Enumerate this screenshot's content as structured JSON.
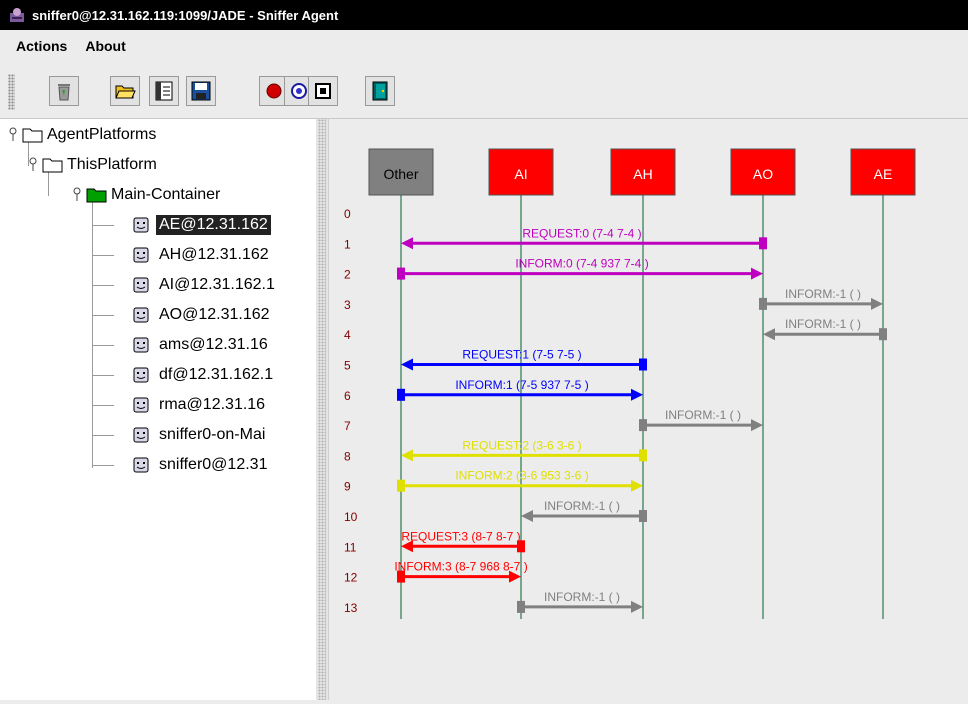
{
  "window": {
    "title": "sniffer0@12.31.162.119:1099/JADE - Sniffer Agent"
  },
  "menu": [
    "Actions",
    "About"
  ],
  "toolbar": {
    "buttons": [
      {
        "name": "clear-canvas-button",
        "icon": "trash-can-icon"
      },
      {
        "name": "open-snapshot-button",
        "icon": "open-folder-icon"
      },
      {
        "name": "display-log-button",
        "icon": "notes-icon"
      },
      {
        "name": "save-snapshot-button",
        "icon": "floppy-disk-icon"
      },
      {
        "name": "do-sniff-button",
        "icon": "red-dot-icon"
      },
      {
        "name": "sniff-target-button",
        "icon": "target-icon"
      },
      {
        "name": "do-not-sniff-button",
        "icon": "square-icon"
      },
      {
        "name": "exit-button",
        "icon": "door-exit-icon"
      }
    ]
  },
  "tree": {
    "root": "AgentPlatforms",
    "platform": "ThisPlatform",
    "container": "Main-Container",
    "agents": [
      "AE@12.31.162",
      "AH@12.31.162",
      "AI@12.31.162.1",
      "AO@12.31.162",
      "ams@12.31.16",
      "df@12.31.162.1",
      "rma@12.31.16",
      "sniffer0-on-Mai",
      "sniffer0@12.31"
    ],
    "selected_index": 0
  },
  "sniffer": {
    "agents": [
      {
        "name": "Other",
        "color": "#808080"
      },
      {
        "name": "AI",
        "color": "#ff0000"
      },
      {
        "name": "AH",
        "color": "#ff0000"
      },
      {
        "name": "AO",
        "color": "#ff0000"
      },
      {
        "name": "AE",
        "color": "#ff0000"
      }
    ],
    "row_numbers": [
      "0",
      "1",
      "2",
      "3",
      "4",
      "5",
      "6",
      "7",
      "8",
      "9",
      "10",
      "11",
      "12",
      "13"
    ],
    "messages": [
      {
        "row": 1,
        "from": 3,
        "to": 0,
        "label": "REQUEST:0 (7-4  7-4    )",
        "color": "#c000c0"
      },
      {
        "row": 2,
        "from": 0,
        "to": 3,
        "label": "INFORM:0 (7-4  937  7-4 )",
        "color": "#c000c0"
      },
      {
        "row": 3,
        "from": 3,
        "to": 4,
        "label": "INFORM:-1 (          )",
        "color": "#808080"
      },
      {
        "row": 4,
        "from": 4,
        "to": 3,
        "label": "INFORM:-1 (          )",
        "color": "#808080"
      },
      {
        "row": 5,
        "from": 2,
        "to": 0,
        "label": "REQUEST:1 (7-5  7-5    )",
        "color": "#0000ff"
      },
      {
        "row": 6,
        "from": 0,
        "to": 2,
        "label": "INFORM:1 (7-5  937  7-5 )",
        "color": "#0000ff"
      },
      {
        "row": 7,
        "from": 2,
        "to": 3,
        "label": "INFORM:-1 (          )",
        "color": "#808080"
      },
      {
        "row": 8,
        "from": 2,
        "to": 0,
        "label": "REQUEST:2 (3-6  3-6    )",
        "color": "#e0e000"
      },
      {
        "row": 9,
        "from": 0,
        "to": 2,
        "label": "INFORM:2 (3-6  953  3-6 )",
        "color": "#e0e000"
      },
      {
        "row": 10,
        "from": 2,
        "to": 1,
        "label": "INFORM:-1 (          )",
        "color": "#808080"
      },
      {
        "row": 11,
        "from": 1,
        "to": 0,
        "label": "REQUEST:3 (8-7  8-7    )",
        "color": "#ff0000"
      },
      {
        "row": 12,
        "from": 0,
        "to": 1,
        "label": "INFORM:3 (8-7  968  8-7 )",
        "color": "#ff0000"
      },
      {
        "row": 13,
        "from": 1,
        "to": 2,
        "label": "INFORM:-1 (          )",
        "color": "#808080"
      }
    ]
  }
}
